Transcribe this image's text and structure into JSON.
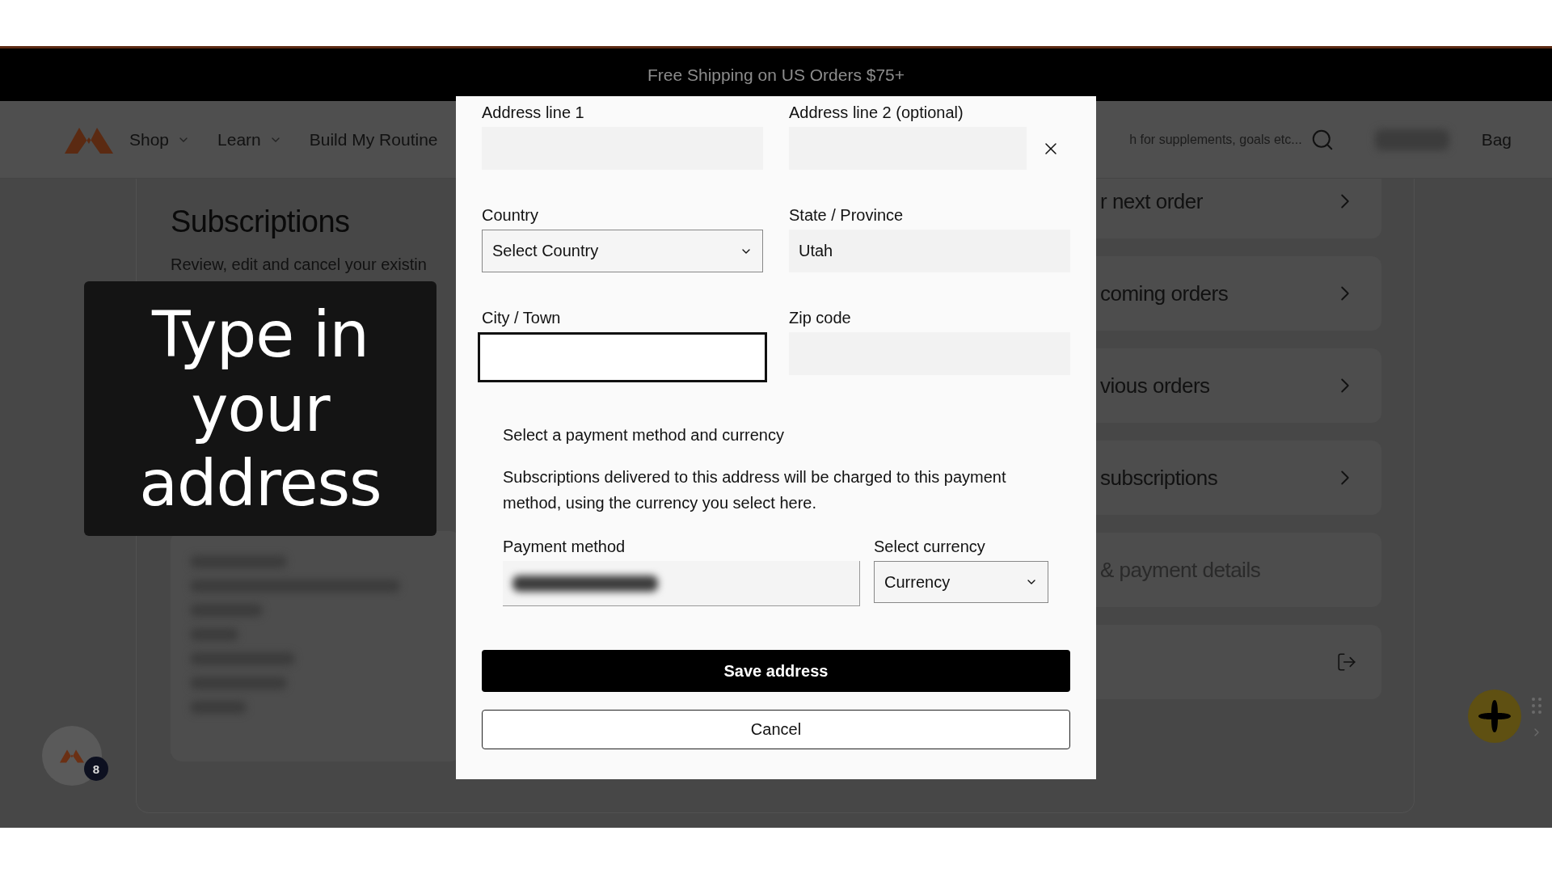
{
  "promo_bar": {
    "text": "Free Shipping on US Orders $75+"
  },
  "nav": {
    "items": [
      {
        "label": "Shop",
        "has_menu": true
      },
      {
        "label": "Learn",
        "has_menu": true
      },
      {
        "label": "Build My Routine",
        "has_menu": false
      }
    ],
    "search": {
      "placeholder": "h for supplements, goals etc..."
    },
    "bag": "Bag"
  },
  "page": {
    "title": "Subscriptions",
    "description": "Review, edit and cancel your existin"
  },
  "account_menu": [
    {
      "label": "r next order",
      "kind": "link"
    },
    {
      "label": "coming orders",
      "kind": "link"
    },
    {
      "label": "vious orders",
      "kind": "link"
    },
    {
      "label": "subscriptions",
      "kind": "link"
    },
    {
      "label": "& payment details",
      "kind": "plain"
    },
    {
      "kind": "logout"
    }
  ],
  "modal": {
    "fields": [
      {
        "label": "Address line 1",
        "kind": "text",
        "focused": false
      },
      {
        "label": "Address line 2 (optional)",
        "kind": "text",
        "focused": false
      },
      {
        "label": "Country",
        "kind": "select",
        "value": "Select Country",
        "focused": false
      },
      {
        "label": "State / Province",
        "kind": "text",
        "value": "Utah",
        "focused": false
      },
      {
        "label": "City / Town",
        "kind": "text",
        "focused": true
      },
      {
        "label": "Zip code",
        "kind": "text",
        "focused": false
      }
    ],
    "payment": {
      "heading": "Select a payment method and currency",
      "note": "Subscriptions delivered to this address will be charged to this payment method, using the currency you select here.",
      "method_label": "Payment method",
      "currency_label": "Select currency",
      "currency_value": "Currency"
    },
    "buttons": [
      {
        "label": "Save address",
        "kind": "primary"
      },
      {
        "label": "Cancel",
        "kind": "secondary"
      }
    ]
  },
  "caption": {
    "text": "Type in your address"
  },
  "chat_widget": {
    "count": "8"
  }
}
